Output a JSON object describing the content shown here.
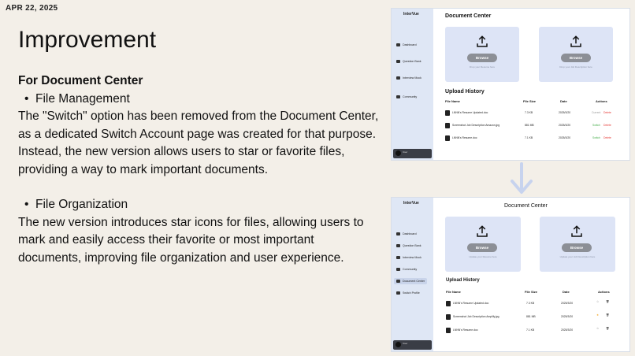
{
  "date": "APR 22, 2025",
  "title": "Improvement",
  "section_heading": "For Document Center",
  "sections": [
    {
      "bullet": "File Management",
      "text": "The \"Switch\" option has been removed from the Document Center, as a dedicated Switch Account page was created for that purpose. Instead, the new version allows users to star or favorite files, providing a way to mark important documents."
    },
    {
      "bullet": "File Organization",
      "text": "The new version introduces star icons for files, allowing users to mark and easily access their favorite or most important documents, improving file organization and user experience."
    }
  ],
  "old_mock": {
    "logo": "InterVue",
    "nav": [
      "Dashboard",
      "Question Bank",
      "Interview Mock",
      "Community"
    ],
    "title": "Document Center",
    "browse": "Browse",
    "hints": [
      "Drop your Resume here",
      "Drop your Job Description here"
    ],
    "upload_history": "Upload History",
    "headers": [
      "File Name",
      "File Size",
      "Date",
      "Actions"
    ],
    "rows": [
      {
        "name": "LNNN's Resume Updated.doc",
        "size": "7.3 KB",
        "date": "2025/3/20",
        "action": "Current",
        "delete": "Delete"
      },
      {
        "name": "Screenshot Job Description Amazon.jpg",
        "size": "881 MB",
        "date": "2025/3/20",
        "action": "Switch",
        "delete": "Delete"
      },
      {
        "name": "LNNN's Resume.doc",
        "size": "7.1 KB",
        "date": "2025/3/20",
        "action": "Switch",
        "delete": "Delete"
      }
    ],
    "user": "User"
  },
  "new_mock": {
    "logo": "InterVue",
    "nav": [
      "Dashboard",
      "Question Bank",
      "Interview Mock",
      "Community",
      "Document Center",
      "Switch Profile"
    ],
    "title": "Document Center",
    "browse": "Browse",
    "hints": [
      "Update your Resume here",
      "Update your Job Description here"
    ],
    "upload_history": "Upload History",
    "headers": [
      "File Name",
      "File Size",
      "Date",
      "Actions"
    ],
    "rows": [
      {
        "name": "LNNN's Resume Updated.doc",
        "size": "7.3 KB",
        "date": "2025/3/20",
        "starred": false
      },
      {
        "name": "Screenshot Job Description Amplify.jpg",
        "size": "881 MB",
        "date": "2025/3/20",
        "starred": true
      },
      {
        "name": "LNNN's Resume.doc",
        "size": "7.1 KB",
        "date": "2025/3/20",
        "starred": false
      }
    ],
    "user": "User"
  },
  "colors": {
    "background": "#f3efe8",
    "card": "#dde4f6",
    "sidebar": "#dfe7f5",
    "arrow": "#c7d3ee",
    "switch": "#4caf50",
    "delete": "#e53935",
    "star": "#f5a623"
  }
}
